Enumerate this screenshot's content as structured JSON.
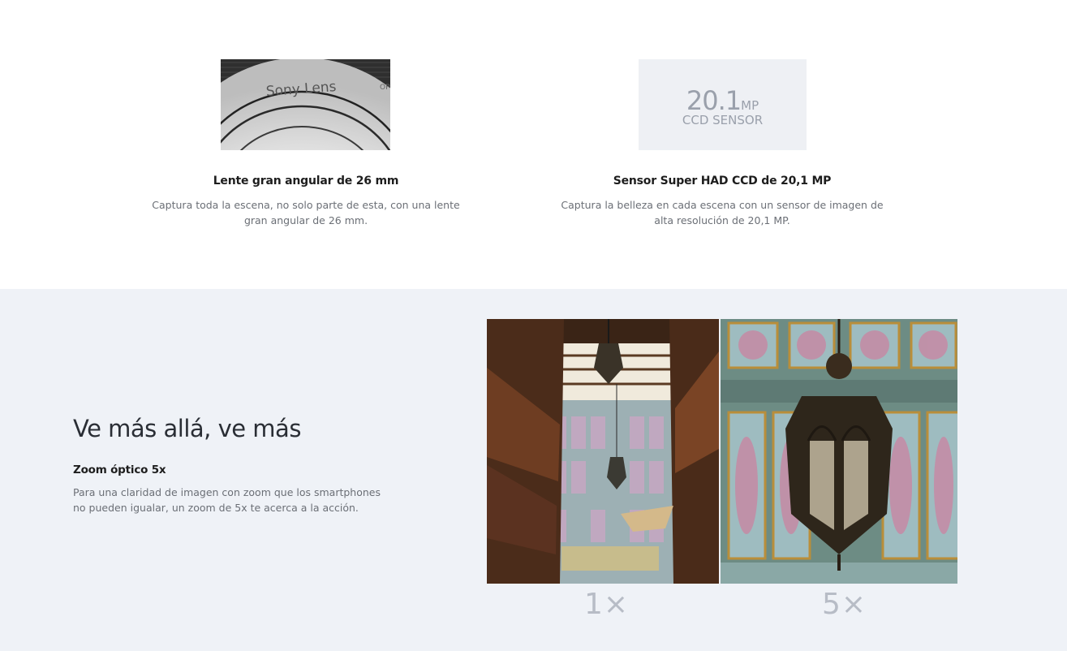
{
  "features": [
    {
      "image_text": "Sony Lens",
      "image_side_text": "OP",
      "title": "Lente gran angular de 26 mm",
      "description": "Captura toda la escena, no solo parte de esta, con una lente gran angular de 26 mm."
    },
    {
      "image_number": "20.1",
      "image_unit": "MP",
      "image_caption": "CCD SENSOR",
      "title": "Sensor Super HAD CCD de 20,1 MP",
      "description": "Captura la belleza en cada escena con un sensor de imagen de alta resolución de 20,1 MP."
    }
  ],
  "zoom": {
    "heading": "Ve más allá, ve más",
    "subheading": "Zoom óptico 5x",
    "description": "Para una claridad de imagen con zoom que los smartphones no pueden igualar, un zoom de 5x te acerca a la acción.",
    "labels": [
      "1×",
      "5×"
    ]
  },
  "colors": {
    "zoom_background": "#eff2f7",
    "label_gray": "#b7bcc6",
    "body_text_gray": "#6b6f76"
  }
}
